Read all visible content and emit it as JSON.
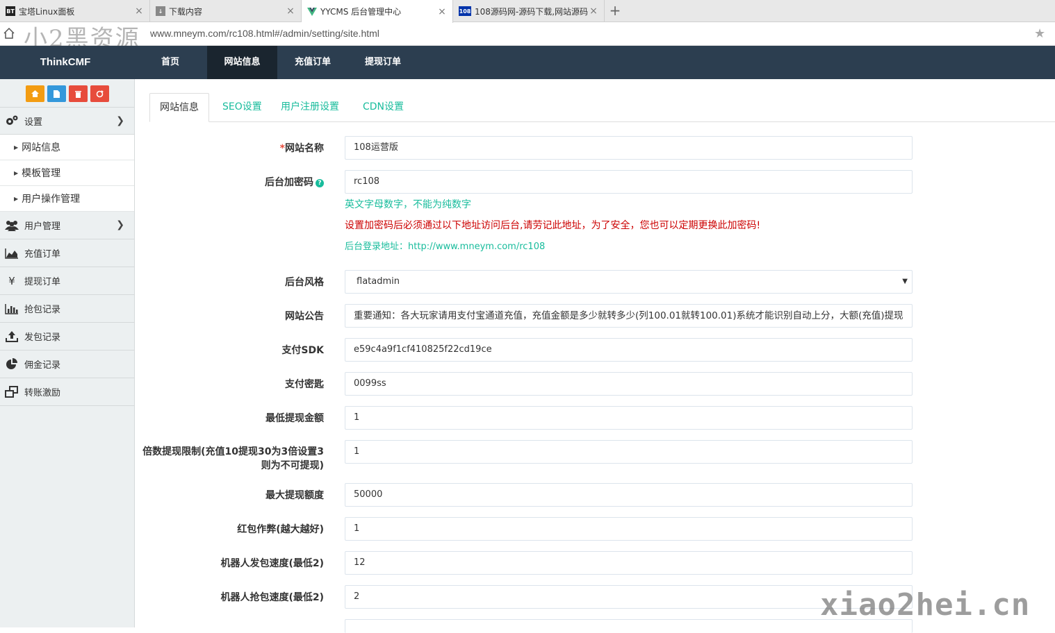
{
  "browser": {
    "tabs": [
      {
        "favicon": "BT",
        "title": "宝塔Linux面板"
      },
      {
        "favicon": "download-icon",
        "title": "下载内容"
      },
      {
        "favicon": "vue-icon",
        "title": "YYCMS 后台管理中心"
      },
      {
        "favicon": "108",
        "title": "108源码网-源码下载,网站源码"
      }
    ],
    "url": "www.mneym.com/rc108.html#/admin/setting/site.html"
  },
  "watermarks": {
    "top": "小2黑资源",
    "bottom": "xiao2hei.cn"
  },
  "navbar": {
    "brand": "ThinkCMF",
    "items": [
      "首页",
      "网站信息",
      "充值订单",
      "提现订单"
    ],
    "active_index": 1,
    "bg_color": "#2c3e50"
  },
  "sidebar": {
    "shortcut_colors": [
      "#f39c12",
      "#3498db",
      "#e74c3c",
      "#e74c3c"
    ],
    "settings_label": "设置",
    "sub_items": [
      "网站信息",
      "模板管理",
      "用户操作管理"
    ],
    "items": [
      "用户管理",
      "充值订单",
      "提现订单",
      "抢包记录",
      "发包记录",
      "佣金记录",
      "转账激励"
    ]
  },
  "content_tabs": [
    "网站信息",
    "SEO设置",
    "用户注册设置",
    "CDN设置"
  ],
  "form": {
    "site_name": {
      "label": "网站名称",
      "value": "108运营版"
    },
    "admin_key": {
      "label": "后台加密码",
      "value": "rc108",
      "hint1": "英文字母数字，不能为纯数字",
      "hint2": "设置加密码后必须通过以下地址访问后台,请劳记此地址，为了安全，您也可以定期更换此加密码!",
      "hint3_prefix": "后台登录地址：",
      "hint3_url": "http://www.mneym.com/rc108"
    },
    "admin_style": {
      "label": "后台风格",
      "value": "flatadmin"
    },
    "notice": {
      "label": "网站公告",
      "value": "重要通知：各大玩家请用支付宝通道充值，充值金额是多少就转多少(列100.01就转100.01)系统才能识别自动上分，大额(充值)提现"
    },
    "pay_sdk": {
      "label": "支付SDK",
      "value": "e59c4a9f1cf410825f22cd19ce"
    },
    "pay_key": {
      "label": "支付密匙",
      "value": "0099ss"
    },
    "min_withdraw": {
      "label": "最低提现金额",
      "value": "1"
    },
    "multiple_limit": {
      "label_line1": "倍数提现限制(充值10提现30为3倍设置3",
      "label_line2": "则为不可提现)",
      "value": "1"
    },
    "max_withdraw": {
      "label": "最大提现额度",
      "value": "50000"
    },
    "cheat": {
      "label": "红包作弊(越大越好)",
      "value": "1"
    },
    "robot_send": {
      "label": "机器人发包速度(最低2)",
      "value": "12"
    },
    "robot_grab": {
      "label": "机器人抢包速度(最低2)",
      "value": "2"
    }
  },
  "colors": {
    "accent": "#18bc9c",
    "danger": "#cc0000",
    "hint": "#18bc9c"
  }
}
